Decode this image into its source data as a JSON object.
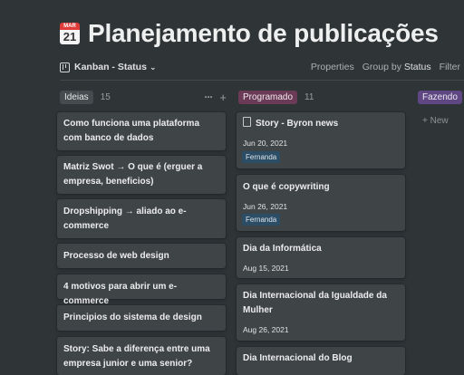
{
  "page": {
    "icon": "calendar-icon",
    "icon_month": "MAR",
    "icon_day": "21",
    "title": "Planejamento de publicações"
  },
  "viewbar": {
    "view_name": "Kanban - Status",
    "properties": "Properties",
    "group_by_label": "Group by",
    "group_by_value": "Status",
    "filter": "Filter"
  },
  "colors": {
    "background": "#2f3437",
    "card": "#3f4447",
    "ideias_tag": "#454b4e",
    "programado_tag": "#6b3a57",
    "fazendo_tag": "#5e4783",
    "person_tag": "#2b4d66"
  },
  "columns": [
    {
      "name": "Ideias",
      "count": "15",
      "cards": [
        {
          "title": "Como funciona uma plataforma com banco de dados"
        },
        {
          "title": "Matriz Swot → O  que é (erguer a empresa, beneficios)"
        },
        {
          "title": "Dropshipping → aliado ao e-commerce"
        },
        {
          "title": "Processo de web design"
        },
        {
          "title": "4 motivos para abrir um e-commerce"
        },
        {
          "title": "Principios do sistema de design"
        },
        {
          "title": "Story: Sabe a diferença entre uma empresa junior e uma senior?"
        }
      ]
    },
    {
      "name": "Programado",
      "count": "11",
      "cards": [
        {
          "title": "Story - Byron news",
          "date": "Jun 20, 2021",
          "person": "Fernanda"
        },
        {
          "title": "O que é copywriting",
          "date": "Jun 26, 2021",
          "person": "Fernanda"
        },
        {
          "title": "Dia da Informática",
          "date": "Aug 15, 2021"
        },
        {
          "title": "Dia Internacional da Igualdade da Mulher",
          "date": "Aug 26, 2021"
        },
        {
          "title": "Dia Internacional do Blog"
        }
      ]
    },
    {
      "name": "Fazendo",
      "new_label": "+ New"
    }
  ]
}
